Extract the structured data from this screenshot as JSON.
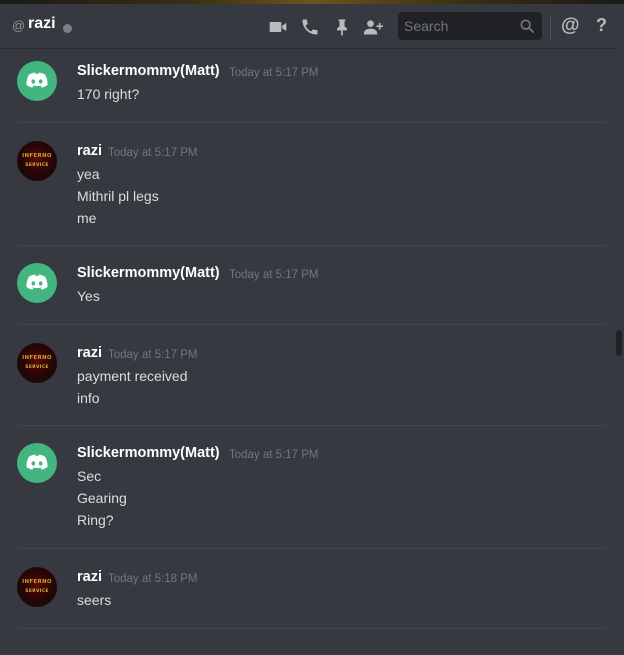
{
  "header": {
    "at": "@",
    "channel": "razi",
    "search_placeholder": "Search",
    "mention": "@",
    "help": "?"
  },
  "icons": {
    "video": "video-camera-icon",
    "call": "phone-icon",
    "pin": "pin-icon",
    "add_friend": "add-friend-icon",
    "search": "search-icon",
    "mention": "at-icon",
    "help": "help-icon"
  },
  "colors": {
    "background": "#36393f",
    "discord_avatar": "#43b581",
    "username": "#ffffff",
    "timestamp": "#72767d",
    "text": "#dcddde"
  },
  "messages": [
    {
      "author": "Slickermommy(Matt)",
      "timestamp": "Today at 5:17 PM",
      "lines": [
        "170 right?"
      ]
    },
    {
      "author": "razi",
      "timestamp": "Today at 5:17 PM",
      "lines": [
        "yea",
        "Mithril pl legs",
        "me"
      ]
    },
    {
      "author": "Slickermommy(Matt)",
      "timestamp": "Today at 5:17 PM",
      "lines": [
        "Yes"
      ]
    },
    {
      "author": "razi",
      "timestamp": "Today at 5:17 PM",
      "lines": [
        "payment received",
        "info"
      ]
    },
    {
      "author": "Slickermommy(Matt)",
      "timestamp": "Today at 5:17 PM",
      "lines": [
        "Sec",
        "Gearing",
        "Ring?"
      ]
    },
    {
      "author": "razi",
      "timestamp": "Today at 5:18 PM",
      "lines": [
        "seers"
      ]
    }
  ],
  "razi_avatar_text": [
    "INFERNO",
    "SERVICE"
  ]
}
